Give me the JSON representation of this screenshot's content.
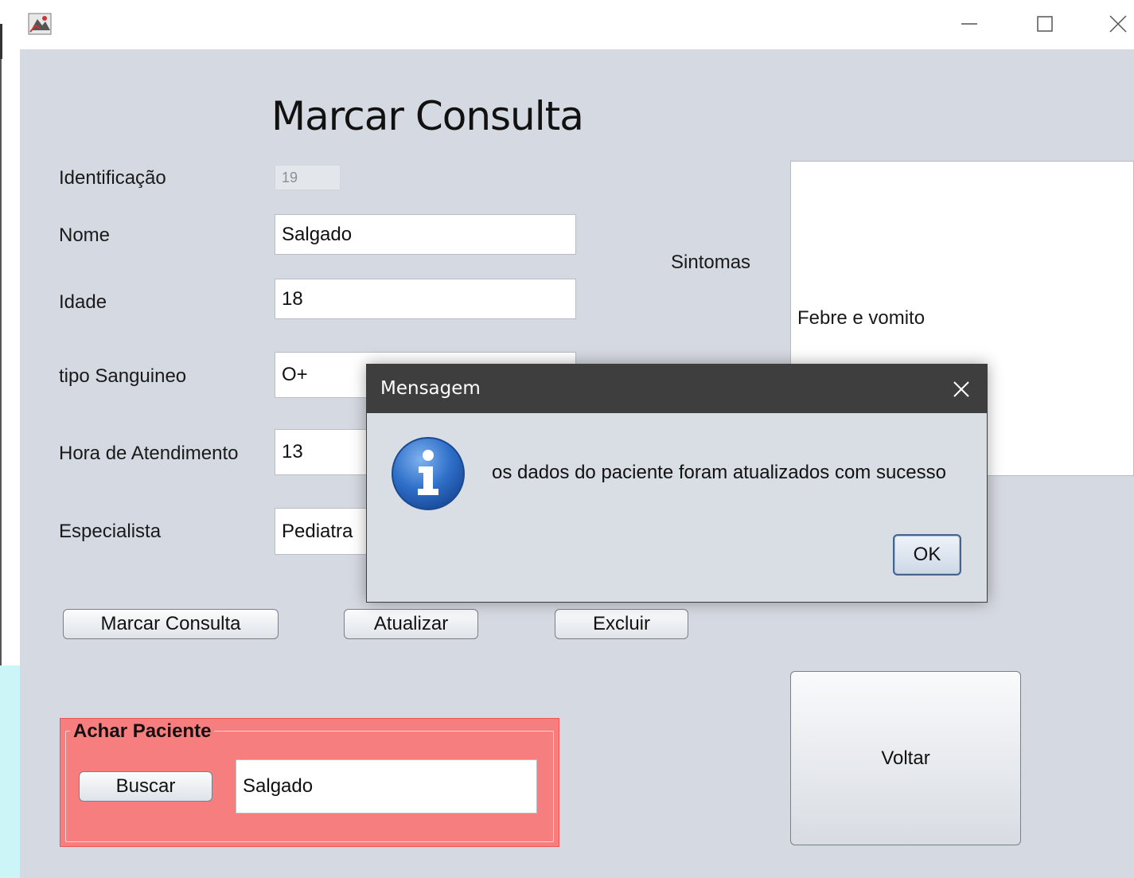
{
  "window": {
    "title": "",
    "controls": [
      "minimize-icon",
      "maximize-icon",
      "close-icon"
    ]
  },
  "form": {
    "title": "Marcar Consulta",
    "fields": {
      "id_label": "Identificação",
      "id_value": "19",
      "nome_label": "Nome",
      "nome_value": "Salgado",
      "idade_label": "Idade",
      "idade_value": "18",
      "tipo_label": "tipo Sanguineo",
      "tipo_value": "O+",
      "hora_label": "Hora de Atendimento",
      "hora_value": "13",
      "especialista_label": "Especialista",
      "especialista_value": "Pediatra",
      "sintomas_label": "Sintomas",
      "sintomas_value": "Febre e vomito"
    },
    "buttons": {
      "marcar": "Marcar Consulta",
      "atualizar": "Atualizar",
      "excluir": "Excluir",
      "voltar": "Voltar"
    }
  },
  "search_panel": {
    "legend": "Achar Paciente",
    "button": "Buscar",
    "value": "Salgado",
    "background_color": "#f67e7e"
  },
  "dialog": {
    "title": "Mensagem",
    "message": "os dados do paciente foram atualizados com sucesso",
    "ok": "OK",
    "icon": "info-icon"
  },
  "colors": {
    "background": "#d5d9e1",
    "dialog_titlebar": "#3e3e3e"
  }
}
